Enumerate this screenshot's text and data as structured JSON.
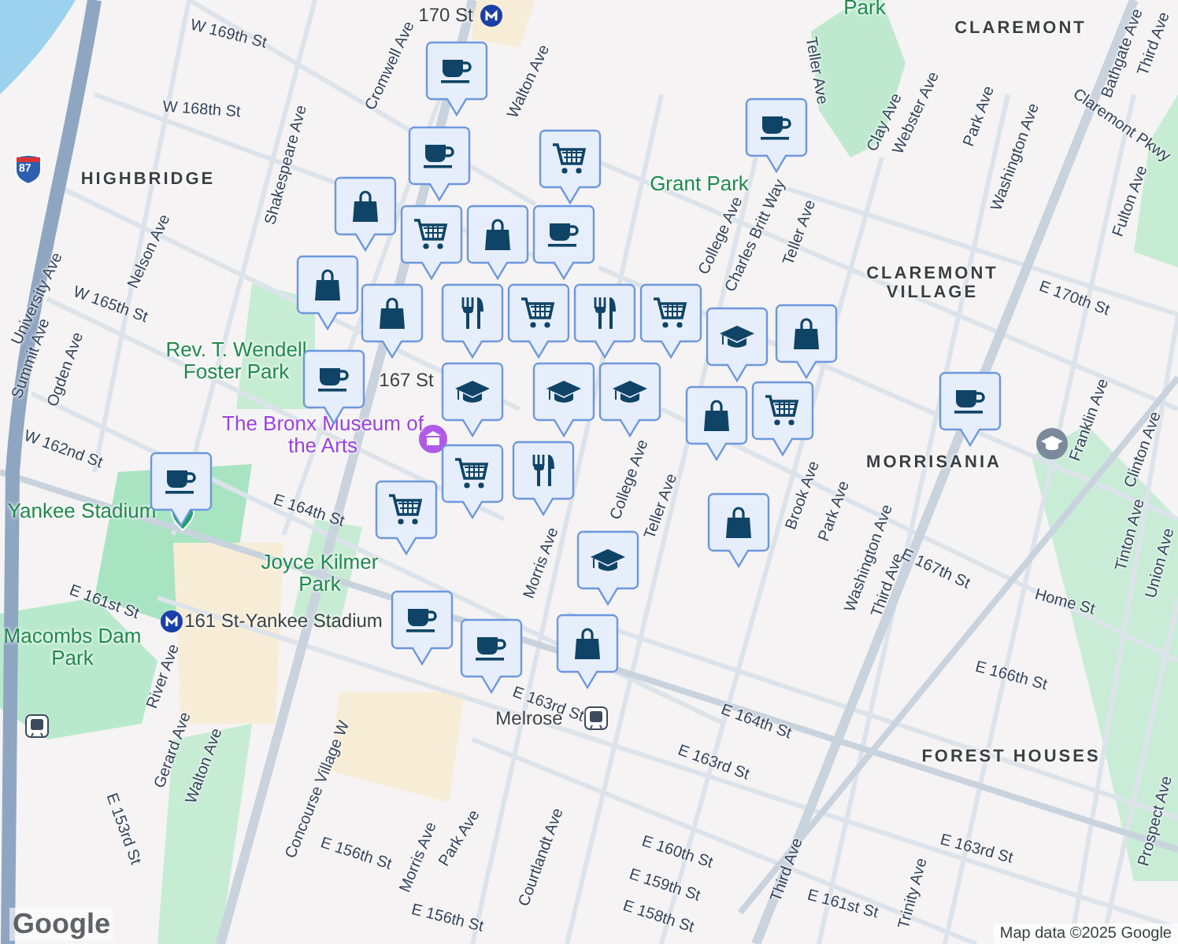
{
  "map": {
    "highway_shield": "87",
    "labels": [
      {
        "text": "HIGHBRIDGE",
        "kind": "neighborhood"
      },
      {
        "text": "CLAREMONT",
        "kind": "neighborhood"
      },
      {
        "text": "CLAREMONT VILLAGE",
        "kind": "neighborhood"
      },
      {
        "text": "MORRISANIA",
        "kind": "neighborhood"
      },
      {
        "text": "FOREST HOUSES",
        "kind": "neighborhood"
      },
      {
        "text": "Park",
        "kind": "park"
      },
      {
        "text": "Grant Park",
        "kind": "park"
      },
      {
        "text": "Rev. T. Wendell Foster Park",
        "kind": "park"
      },
      {
        "text": "Joyce Kilmer Park",
        "kind": "park"
      },
      {
        "text": "Yankee Stadium",
        "kind": "park"
      },
      {
        "text": "Macombs Dam Park",
        "kind": "park"
      },
      {
        "text": "170 St",
        "kind": "transit"
      },
      {
        "text": "The Bronx Museum of the Arts",
        "kind": "poi"
      },
      {
        "text": "161 St-Yankee Stadium",
        "kind": "transit"
      },
      {
        "text": "Melrose",
        "kind": "transit"
      },
      {
        "text": "167 St",
        "kind": "transit"
      },
      {
        "text": "W 169th St",
        "kind": "street"
      },
      {
        "text": "W 168th St",
        "kind": "street"
      },
      {
        "text": "Cromwell Ave",
        "kind": "street"
      },
      {
        "text": "Walton Ave",
        "kind": "street"
      },
      {
        "text": "Shakespeare Ave",
        "kind": "street"
      },
      {
        "text": "University Ave",
        "kind": "street"
      },
      {
        "text": "Nelson Ave",
        "kind": "street"
      },
      {
        "text": "Summit Ave",
        "kind": "street"
      },
      {
        "text": "Ogden Ave",
        "kind": "street"
      },
      {
        "text": "W 165th St",
        "kind": "street"
      },
      {
        "text": "W 162nd St",
        "kind": "street"
      },
      {
        "text": "E 164th St",
        "kind": "street"
      },
      {
        "text": "E 161st St",
        "kind": "street"
      },
      {
        "text": "River Ave",
        "kind": "street"
      },
      {
        "text": "Gerard Ave",
        "kind": "street"
      },
      {
        "text": "Walton Ave",
        "kind": "street"
      },
      {
        "text": "E 153rd St",
        "kind": "street"
      },
      {
        "text": "Concourse Village W",
        "kind": "street"
      },
      {
        "text": "E 156th St",
        "kind": "street"
      },
      {
        "text": "Morris Ave",
        "kind": "street"
      },
      {
        "text": "Park Ave",
        "kind": "street"
      },
      {
        "text": "Courtlandt Ave",
        "kind": "street"
      },
      {
        "text": "E 156th St",
        "kind": "street"
      },
      {
        "text": "Morris Ave",
        "kind": "street"
      },
      {
        "text": "College Ave",
        "kind": "street"
      },
      {
        "text": "Teller Ave",
        "kind": "street"
      },
      {
        "text": "Brook Ave",
        "kind": "street"
      },
      {
        "text": "Park Ave",
        "kind": "street"
      },
      {
        "text": "Washington Ave",
        "kind": "street"
      },
      {
        "text": "Third Ave",
        "kind": "street"
      },
      {
        "text": "E 167th St",
        "kind": "street"
      },
      {
        "text": "Home St",
        "kind": "street"
      },
      {
        "text": "E 166th St",
        "kind": "street"
      },
      {
        "text": "E 164th St",
        "kind": "street"
      },
      {
        "text": "E 163rd St",
        "kind": "street"
      },
      {
        "text": "E 163rd St",
        "kind": "street"
      },
      {
        "text": "E 161st St",
        "kind": "street"
      },
      {
        "text": "E 160th St",
        "kind": "street"
      },
      {
        "text": "E 159th St",
        "kind": "street"
      },
      {
        "text": "E 158th St",
        "kind": "street"
      },
      {
        "text": "Third Ave",
        "kind": "street"
      },
      {
        "text": "Trinity Ave",
        "kind": "street"
      },
      {
        "text": "Tinton Ave",
        "kind": "street"
      },
      {
        "text": "Union Ave",
        "kind": "street"
      },
      {
        "text": "Prospect Ave",
        "kind": "street"
      },
      {
        "text": "Teller Ave",
        "kind": "street"
      },
      {
        "text": "Clay Ave",
        "kind": "street"
      },
      {
        "text": "Webster Ave",
        "kind": "street"
      },
      {
        "text": "Park Ave",
        "kind": "street"
      },
      {
        "text": "Washington Ave",
        "kind": "street"
      },
      {
        "text": "Bathgate Ave",
        "kind": "street"
      },
      {
        "text": "Third Ave",
        "kind": "street"
      },
      {
        "text": "Claremont Pkwy",
        "kind": "street"
      },
      {
        "text": "Fulton Ave",
        "kind": "street"
      },
      {
        "text": "E 170th St",
        "kind": "street"
      },
      {
        "text": "Franklin Ave",
        "kind": "street"
      },
      {
        "text": "Clinton Ave",
        "kind": "street"
      },
      {
        "text": "College Ave",
        "kind": "street"
      },
      {
        "text": "Charles Britt Way",
        "kind": "street"
      },
      {
        "text": "Teller Ave",
        "kind": "street"
      },
      {
        "text": "E 163rd St",
        "kind": "street"
      }
    ],
    "markers": [
      {
        "kind": "coffee"
      },
      {
        "kind": "coffee"
      },
      {
        "kind": "cart"
      },
      {
        "kind": "coffee"
      },
      {
        "kind": "bag"
      },
      {
        "kind": "cart"
      },
      {
        "kind": "bag"
      },
      {
        "kind": "bag"
      },
      {
        "kind": "bag"
      },
      {
        "kind": "coffee"
      },
      {
        "kind": "food"
      },
      {
        "kind": "cart"
      },
      {
        "kind": "food"
      },
      {
        "kind": "cart"
      },
      {
        "kind": "school"
      },
      {
        "kind": "food"
      },
      {
        "kind": "school"
      },
      {
        "kind": "school"
      },
      {
        "kind": "school"
      },
      {
        "kind": "bag"
      },
      {
        "kind": "cart"
      },
      {
        "kind": "bag"
      },
      {
        "kind": "coffee"
      },
      {
        "kind": "coffee"
      },
      {
        "kind": "cart"
      },
      {
        "kind": "cart"
      },
      {
        "kind": "coffee"
      },
      {
        "kind": "school"
      },
      {
        "kind": "bag"
      },
      {
        "kind": "coffee"
      },
      {
        "kind": "coffee"
      },
      {
        "kind": "bag"
      }
    ]
  },
  "attribution": {
    "logo": "Google",
    "credit": "Map data ©2025 Google"
  }
}
